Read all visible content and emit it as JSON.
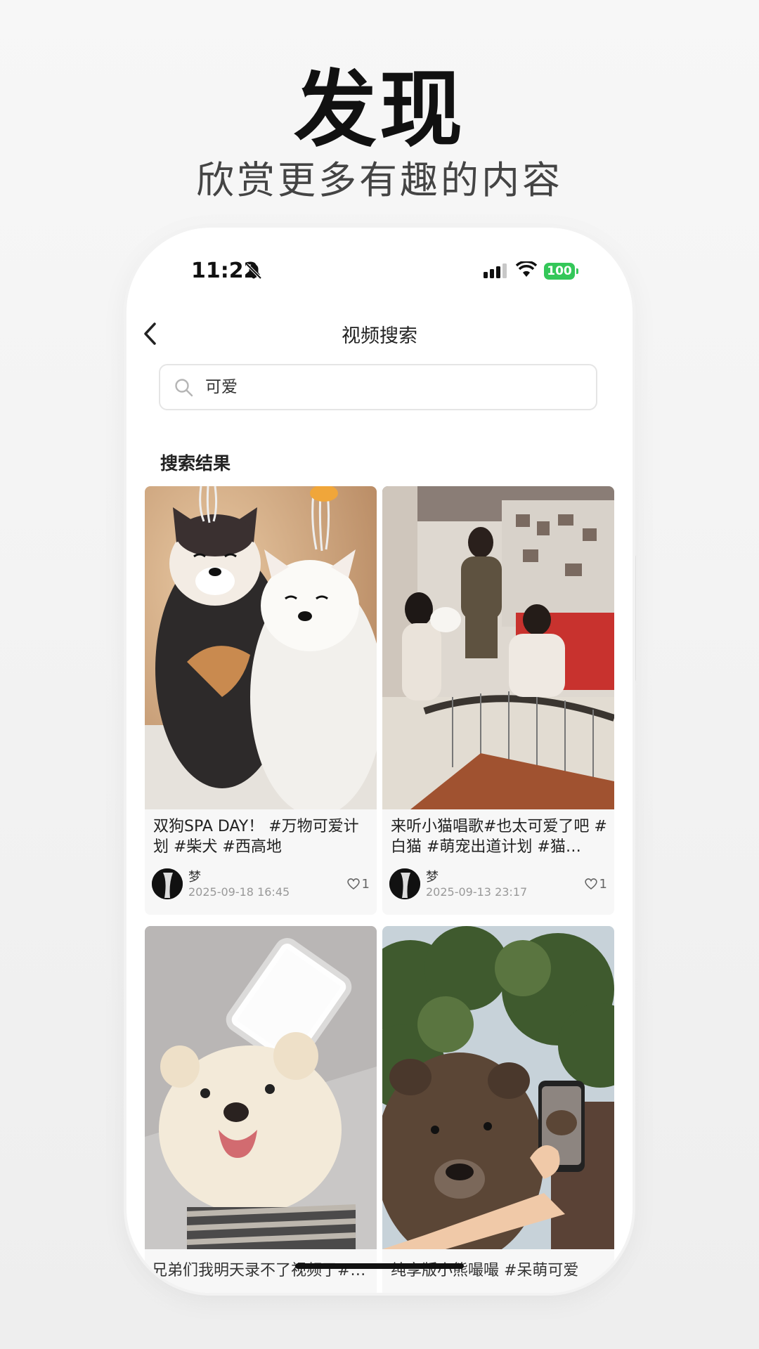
{
  "hero": {
    "title": "发现",
    "subtitle": "欣赏更多有趣的内容"
  },
  "status_bar": {
    "time": "11:22",
    "battery": "100"
  },
  "nav": {
    "title": "视频搜索",
    "back_icon": "chevron-left-icon"
  },
  "search": {
    "value": "可爱",
    "icon": "search-icon"
  },
  "results": {
    "title": "搜索结果",
    "items": [
      {
        "caption": "双狗SPA DAY！ #万物可爱计划 #柴犬 #西高地",
        "author": "梦",
        "date": "2025-09-18 16:45",
        "likes": "1"
      },
      {
        "caption": "来听小猫唱歌#也太可爱了吧 #白猫 #萌宠出道计划 #猫…",
        "author": "梦",
        "date": "2025-09-13 23:17",
        "likes": "1"
      },
      {
        "caption": "兄弟们我明天录不了视频了#…"
      },
      {
        "caption": "纯享版小熊嘬嘬 #呆萌可爱"
      }
    ]
  },
  "colors": {
    "battery": "#34c759",
    "background": "#f2f2f2"
  }
}
